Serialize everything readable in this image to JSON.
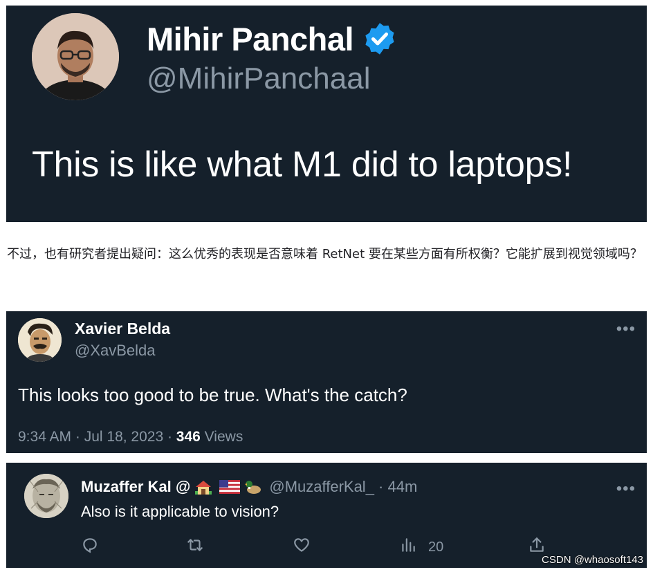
{
  "tweet1": {
    "author_name": "Mihir Panchal",
    "handle": "@MihirPanchaal",
    "verified_icon": "verified-badge-icon",
    "text": "This is like what M1 did to laptops!"
  },
  "paragraph": {
    "text": "不过，也有研究者提出疑问：这么优秀的表现是否意味着 RetNet 要在某些方面有所权衡？它能扩展到视觉领域吗？"
  },
  "tweet2": {
    "author_name": "Xavier Belda",
    "handle": "@XavBelda",
    "more": "•••",
    "text": "This looks too good to be true. What's the catch?",
    "time": "9:34 AM · Jul 18, 2023 · ",
    "views_count": "346",
    "views_label": " Views"
  },
  "tweet3": {
    "author_name": "Muzaffer Kal @",
    "handle": "@MuzafferKal_ · 44m",
    "more": "•••",
    "text": "Also is it applicable to vision?",
    "emoji_icons": [
      "house-emoji-icon",
      "us-flag-emoji-icon",
      "duck-emoji-icon"
    ],
    "actions": {
      "reply_icon": "reply-icon",
      "retweet_icon": "retweet-icon",
      "like_icon": "heart-icon",
      "views_icon": "analytics-icon",
      "views_count": "20",
      "share_icon": "share-icon"
    }
  },
  "watermark": "CSDN @whaosoft143",
  "colors": {
    "card_bg": "#15202b",
    "muted": "#8b98a5",
    "verified_blue": "#1d9bf0"
  }
}
